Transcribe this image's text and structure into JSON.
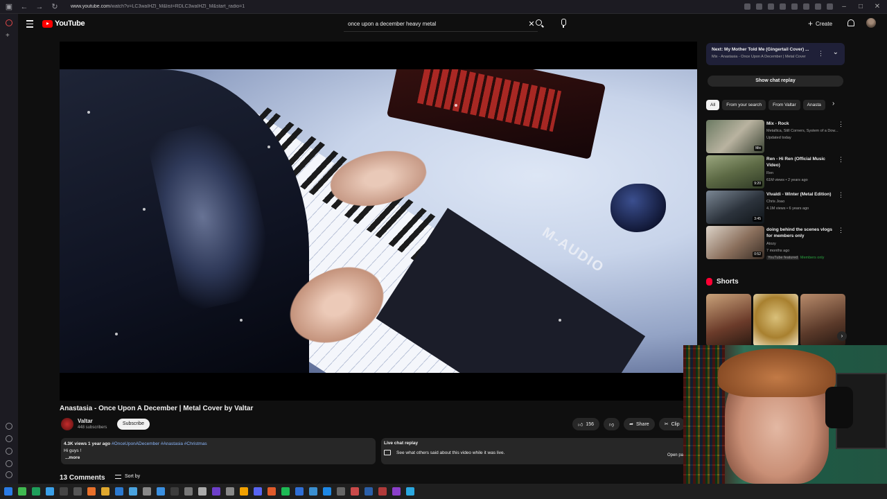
{
  "browser": {
    "url_host": "www.youtube.com",
    "url_path": "/watch?v=LC3waIHZI_M&list=RDLC3waIHZI_M&start_radio=1"
  },
  "header": {
    "logo_text": "YouTube",
    "search_value": "once upon a december heavy metal",
    "create_label": "Create"
  },
  "video": {
    "brand_on_keyboard": "M-AUDIO",
    "title": "Anastasia - Once Upon A December | Metal Cover by Valtar",
    "channel": "Valtar",
    "subscribers": "448 subscribers",
    "subscribe_label": "Subscribe",
    "likes": "156",
    "share_label": "Share",
    "clip_label": "Clip"
  },
  "description": {
    "stats": "4.3K views  1 year ago",
    "tags": "#OnceUponADecember #Anastasia #Christmas",
    "line1": "Hi guys !",
    "more": "...more"
  },
  "live_chat": {
    "title": "Live chat replay",
    "text": "See what others said about this video while it was live.",
    "open_panel": "Open pa"
  },
  "comments": {
    "count_label": "13 Comments",
    "sort_label": "Sort by"
  },
  "sidebar": {
    "next_title": "Next: My Mother Told Me (Gingertail Cover) ...",
    "next_sub": "Mix - Anastasia - Once Upon A December | Metal Cover",
    "show_chat_replay": "Show chat replay",
    "chips": [
      "All",
      "From your search",
      "From Valtar",
      "Anasta"
    ],
    "recommendations": [
      {
        "title": "Mix - Rock",
        "meta1": "Metallica, Still Corners, System of a Dow...",
        "meta2": "Updated today",
        "badge": "Mix"
      },
      {
        "title": "Ren - Hi Ren (Official Music Video)",
        "meta1": "Ren",
        "meta2": "61M views • 2 years ago",
        "badge": "9:20"
      },
      {
        "title": "Vivaldi - Winter (Metal Edition)",
        "meta1": "Chris Joao",
        "meta2": "4.1M views • 6 years ago",
        "badge": "3:45"
      },
      {
        "title": "doing behind the scenes vlogs for members only",
        "meta1": "Atozy",
        "meta2": "7 months ago",
        "meta3a": "YouTube featured",
        "meta3b": "Members only",
        "badge": "0:52"
      }
    ],
    "shorts_title": "Shorts"
  }
}
